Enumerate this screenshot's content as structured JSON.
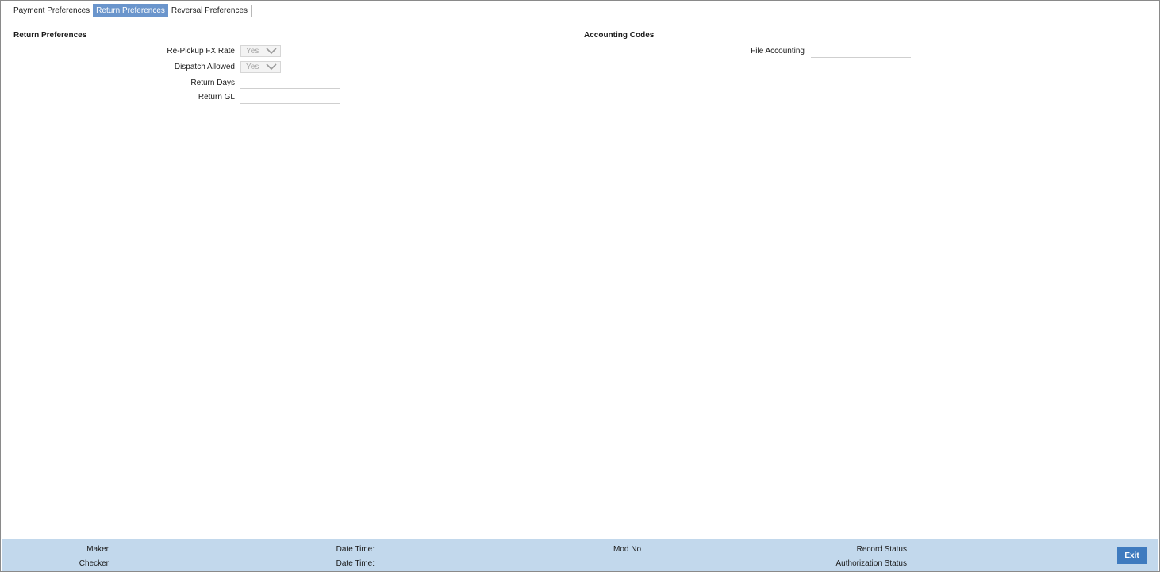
{
  "tabs": [
    {
      "label": "Payment Preferences",
      "active": false
    },
    {
      "label": "Return Preferences",
      "active": true
    },
    {
      "label": "Reversal Preferences",
      "active": false
    }
  ],
  "return_preferences": {
    "title": "Return Preferences",
    "repickup_fx_rate": {
      "label": "Re-Pickup FX Rate",
      "value": "Yes"
    },
    "dispatch_allowed": {
      "label": "Dispatch Allowed",
      "value": "Yes"
    },
    "return_days": {
      "label": "Return Days",
      "value": ""
    },
    "return_gl": {
      "label": "Return GL",
      "value": ""
    }
  },
  "accounting_codes": {
    "title": "Accounting Codes",
    "file_accounting": {
      "label": "File Accounting",
      "value": ""
    }
  },
  "footer": {
    "maker": "Maker",
    "checker": "Checker",
    "date_time_1": "Date Time:",
    "date_time_2": "Date Time:",
    "mod_no": "Mod No",
    "record_status": "Record Status",
    "authorization_status": "Authorization Status",
    "exit_label": "Exit"
  },
  "colors": {
    "active_tab": "#6a95cc",
    "footer_bg": "#c2d8ec",
    "exit_button": "#3f7bbf"
  }
}
